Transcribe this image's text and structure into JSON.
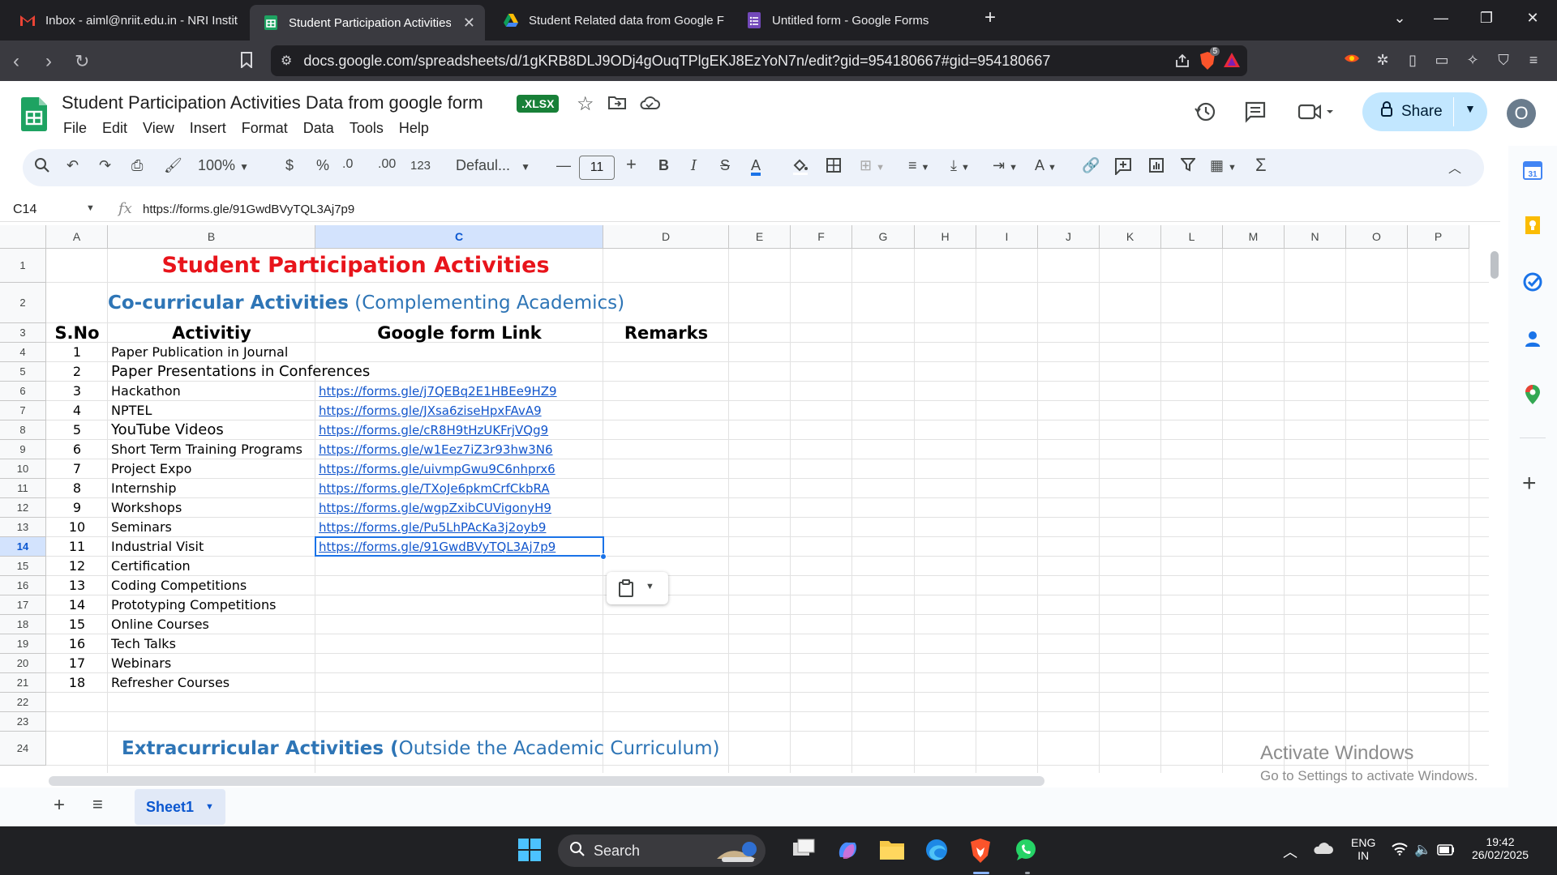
{
  "browser": {
    "tabs": [
      {
        "label": "Inbox - aiml@nriit.edu.in - NRI Instit",
        "active": false
      },
      {
        "label": "Student Participation Activities",
        "active": true
      },
      {
        "label": "Student Related data from Google F",
        "active": false
      },
      {
        "label": "Untitled form - Google Forms",
        "active": false
      }
    ],
    "url": "docs.google.com/spreadsheets/d/1gKRB8DLJ9ODj4gOuqTPlgEKJ8EzYoN7n/edit?gid=954180667#gid=954180667",
    "shield_count": "5"
  },
  "sheets": {
    "title": "Student Participation Activities Data from google form",
    "badge": ".XLSX",
    "menu": [
      "File",
      "Edit",
      "View",
      "Insert",
      "Format",
      "Data",
      "Tools",
      "Help"
    ],
    "share_label": "Share",
    "avatar_letter": "O",
    "toolbar": {
      "zoom": "100%",
      "currency": "$",
      "percent": "%",
      "dec_decrease": ".0",
      "dec_increase": ".00",
      "number_format": "123",
      "font": "Defaul...",
      "font_size": "11"
    },
    "formula_bar": {
      "cell_ref": "C14",
      "fx": "fx",
      "value": "https://forms.gle/91GwdBVyTQL3Aj7p9"
    },
    "columns": [
      "A",
      "B",
      "C",
      "D",
      "E",
      "F",
      "G",
      "H",
      "I",
      "J",
      "K",
      "L",
      "M",
      "N",
      "O",
      "P"
    ],
    "rows": [
      "1",
      "2",
      "3",
      "4",
      "5",
      "6",
      "7",
      "8",
      "9",
      "10",
      "11",
      "12",
      "13",
      "14",
      "15",
      "16",
      "17",
      "18",
      "19",
      "20",
      "21",
      "22",
      "23",
      "24"
    ],
    "content": {
      "title": "Student Participation Activities",
      "subtitle_bold": "Co-curricular Activities",
      "subtitle_rest": " (Complementing Academics)",
      "header_sno": "S.No",
      "header_activity": "Activitiy",
      "header_link": "Google form Link",
      "header_remarks": "Remarks",
      "extra_bold": "Extracurricular Activities (",
      "extra_rest": "Outside the Academic Curriculum)"
    },
    "activities": [
      {
        "sno": "1",
        "name": "Paper Publication in Journal",
        "link": ""
      },
      {
        "sno": "2",
        "name": "Paper Presentations in Conferences",
        "link": ""
      },
      {
        "sno": "3",
        "name": "Hackathon",
        "link": "https://forms.gle/j7QEBq2E1HBEe9HZ9"
      },
      {
        "sno": "4",
        "name": "NPTEL",
        "link": "https://forms.gle/JXsa6ziseHpxFAvA9"
      },
      {
        "sno": "5",
        "name": "YouTube Videos",
        "link": "https://forms.gle/cR8H9tHzUKFrjVQg9"
      },
      {
        "sno": "6",
        "name": "Short Term Training Programs",
        "link": "https://forms.gle/w1Eez7iZ3r93hw3N6"
      },
      {
        "sno": "7",
        "name": "Project Expo",
        "link": "https://forms.gle/uivmpGwu9C6nhprx6"
      },
      {
        "sno": "8",
        "name": "Internship",
        "link": "https://forms.gle/TXoJe6pkmCrfCkbRA"
      },
      {
        "sno": "9",
        "name": "Workshops",
        "link": "https://forms.gle/wgpZxibCUVigonyH9"
      },
      {
        "sno": "10",
        "name": " Seminars",
        "link": "https://forms.gle/Pu5LhPAcKa3j2oyb9"
      },
      {
        "sno": "11",
        "name": " Industrial Visit",
        "link": "https://forms.gle/91GwdBVyTQL3Aj7p9"
      },
      {
        "sno": "12",
        "name": "Certification",
        "link": ""
      },
      {
        "sno": "13",
        "name": "Coding Competitions",
        "link": ""
      },
      {
        "sno": "14",
        "name": "Prototyping Competitions",
        "link": ""
      },
      {
        "sno": "15",
        "name": "Online Courses",
        "link": ""
      },
      {
        "sno": "16",
        "name": "Tech Talks",
        "link": ""
      },
      {
        "sno": "17",
        "name": "Webinars",
        "link": ""
      },
      {
        "sno": "18",
        "name": "Refresher Courses",
        "link": ""
      }
    ],
    "sheet_tab": "Sheet1",
    "watermark": {
      "line1": "Activate Windows",
      "line2": "Go to Settings to activate Windows."
    }
  },
  "taskbar": {
    "search_label": "Search",
    "lang_line1": "ENG",
    "lang_line2": "IN",
    "time": "19:42",
    "date": "26/02/2025"
  },
  "colors": {
    "title_red": "#e8141b",
    "heading_blue": "#2e75b6",
    "link_blue": "#1155cc",
    "selection_blue": "#1a73e8",
    "share_bg": "#c2e7ff",
    "sheets_green": "#188038"
  }
}
